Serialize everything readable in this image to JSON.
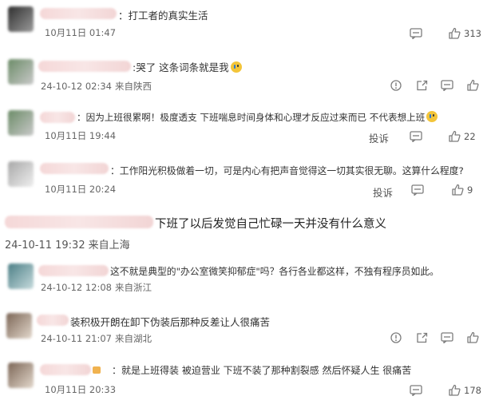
{
  "comments": [
    {
      "text": "：打工者的真实生活",
      "time": "10月11日 01:47",
      "location": "",
      "like_count": "313",
      "report": ""
    },
    {
      "text": ":哭了 这条词条就是我",
      "time": "24-10-12 02:34",
      "location": "来自陕西",
      "like_count": "",
      "report": ""
    },
    {
      "text": "：因为上班很累啊！极度透支 下班喘息时间身体和心理才反应过来而已 不代表想上班",
      "time": "10月11日 19:44",
      "location": "",
      "like_count": "22",
      "report": "投诉"
    },
    {
      "text": "：工作阳光积极做着一切，可是内心有把声音觉得这一切其实很无聊。这算什么程度?",
      "time": "10月11日 20:24",
      "location": "",
      "like_count": "9",
      "report": "投诉"
    },
    {
      "text": "下班了以后发觉自己忙碌一天并没有什么意义",
      "time": "24-10-11 19:32",
      "location": "来自上海",
      "like_count": "",
      "report": ""
    },
    {
      "text": "这不就是典型的\"办公室微笑抑郁症\"吗？各行各业都这样，不独有程序员如此。",
      "time": "24-10-12 12:08",
      "location": "来自浙江",
      "like_count": "",
      "report": ""
    },
    {
      "text": "装积极开朗在卸下伪装后那种反差让人很痛苦",
      "time": "24-10-11 21:07",
      "location": "来自湖北",
      "like_count": "",
      "report": ""
    },
    {
      "text": "：就是上班得装 被迫营业 下班不装了那种割裂感 然后怀疑人生 很痛苦",
      "time": "10月11日 20:33",
      "location": "",
      "like_count": "178",
      "report": ""
    }
  ],
  "icons": {
    "comment": "comment-icon",
    "like": "thumbs-up-icon",
    "share": "share-icon",
    "warning": "warning-icon",
    "more": "more-icon"
  },
  "colors": {
    "text": "#333333",
    "meta": "#666666",
    "icon": "#7c7c7c",
    "blurred_name": "#f5d8d8"
  }
}
